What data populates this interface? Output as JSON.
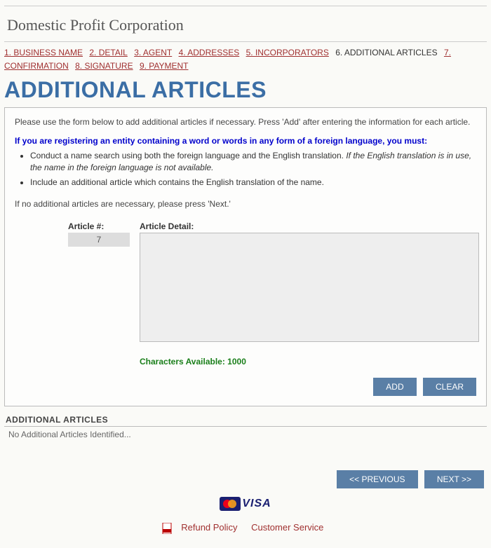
{
  "page_title": "Domestic Profit Corporation",
  "steps": [
    {
      "label": "1. BUSINESS NAME",
      "current": false
    },
    {
      "label": "2. DETAIL",
      "current": false
    },
    {
      "label": "3. AGENT",
      "current": false
    },
    {
      "label": "4. ADDRESSES",
      "current": false
    },
    {
      "label": "5. INCORPORATORS",
      "current": false
    },
    {
      "label": "6. ADDITIONAL ARTICLES",
      "current": true
    },
    {
      "label": "7. CONFIRMATION",
      "current": false
    },
    {
      "label": "8. SIGNATURE",
      "current": false
    },
    {
      "label": "9. PAYMENT",
      "current": false
    }
  ],
  "section_heading": "ADDITIONAL ARTICLES",
  "intro_text": "Please use the form below to add additional articles if necessary. Press 'Add' after entering the information for each article.",
  "foreign_notice": "If you are registering an entity containing a word or words in any form of a foreign language, you must:",
  "bullets": {
    "b1_plain": "Conduct a name search using both the foreign language and the English translation. ",
    "b1_italic": "If the English translation is in use, the name in the foreign language is not available.",
    "b2": "Include an additional article which contains the English translation of the name."
  },
  "no_articles_note": "If no additional articles are necessary, please press 'Next.'",
  "form": {
    "article_num_label": "Article #:",
    "article_num_value": "7",
    "article_detail_label": "Article Detail:",
    "article_detail_value": "",
    "chars_available_label": "Characters Available: ",
    "chars_available_value": "1000",
    "add_label": "ADD",
    "clear_label": "CLEAR"
  },
  "list": {
    "heading": "ADDITIONAL ARTICLES",
    "empty_msg": "No Additional Articles Identified..."
  },
  "nav": {
    "prev_label": "<< PREVIOUS",
    "next_label": "NEXT >>"
  },
  "payment_brands": {
    "visa": "VISA"
  },
  "footer": {
    "refund": "Refund Policy",
    "customer": "Customer Service"
  }
}
